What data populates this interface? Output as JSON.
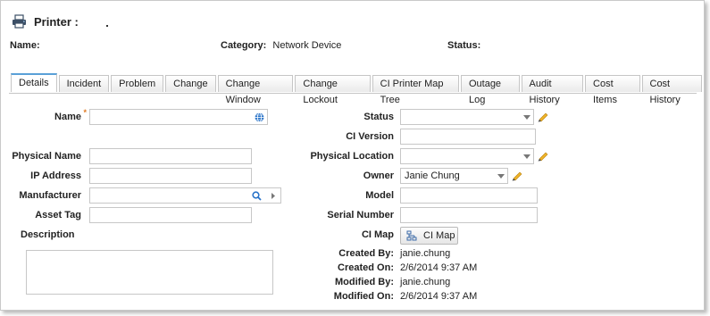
{
  "header": {
    "title": "Printer :",
    "name_label": "Name:",
    "category_label": "Category:",
    "category_value": "Network Device",
    "status_label": "Status:"
  },
  "tabs": [
    {
      "label": "Details",
      "active": true
    },
    {
      "label": "Incident"
    },
    {
      "label": "Problem"
    },
    {
      "label": "Change"
    },
    {
      "label": "Change Window"
    },
    {
      "label": "Change Lockout"
    },
    {
      "label": "CI Printer Map Tree"
    },
    {
      "label": "Outage Log"
    },
    {
      "label": "Audit History"
    },
    {
      "label": "Cost Items"
    },
    {
      "label": "Cost History"
    }
  ],
  "form": {
    "name_label": "Name",
    "required_mark": "*",
    "name_value": "",
    "physical_name_label": "Physical Name",
    "ip_address_label": "IP Address",
    "manufacturer_label": "Manufacturer",
    "asset_tag_label": "Asset Tag",
    "description_label": "Description",
    "status_label": "Status",
    "ci_version_label": "CI Version",
    "physical_location_label": "Physical Location",
    "owner_label": "Owner",
    "owner_value": "Janie Chung",
    "model_label": "Model",
    "serial_number_label": "Serial Number",
    "ci_map_label": "CI Map",
    "ci_map_button": "CI Map",
    "created_by_label": "Created By:",
    "created_by_value": "janie.chung",
    "created_on_label": "Created On:",
    "created_on_value": "2/6/2014 9:37 AM",
    "modified_by_label": "Modified By:",
    "modified_by_value": "janie.chung",
    "modified_on_label": "Modified On:",
    "modified_on_value": "2/6/2014 9:37 AM"
  },
  "icons": {
    "title": "printer-icon",
    "name_field": "globe-icon",
    "manufacturer_search": "magnifier-icon",
    "manufacturer_expand": "triangle-right-icon",
    "dropdown": "triangle-down-icon",
    "edit": "pencil-icon",
    "ci_map": "network-map-icon"
  },
  "colors": {
    "active_tab_accent": "#5aa0d8",
    "globe": "#2a74c9",
    "pencil": "#f0b429",
    "required": "#e07a22"
  }
}
